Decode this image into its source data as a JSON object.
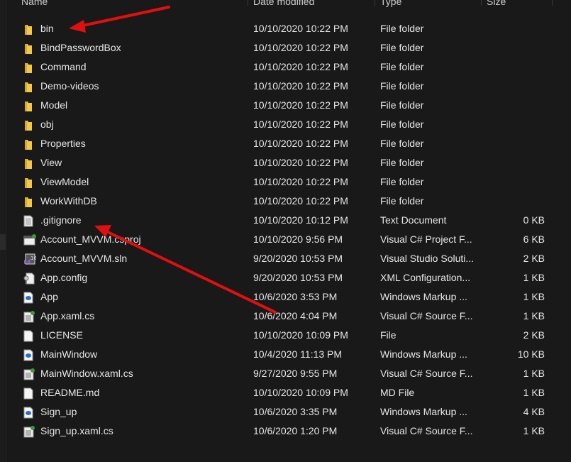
{
  "columns": {
    "name": "Name",
    "date": "Date modified",
    "type": "Type",
    "size": "Size"
  },
  "files": [
    {
      "name": "bin",
      "date": "10/10/2020 10:22 PM",
      "type": "File folder",
      "size": "",
      "icon": "folder"
    },
    {
      "name": "BindPasswordBox",
      "date": "10/10/2020 10:22 PM",
      "type": "File folder",
      "size": "",
      "icon": "folder"
    },
    {
      "name": "Command",
      "date": "10/10/2020 10:22 PM",
      "type": "File folder",
      "size": "",
      "icon": "folder"
    },
    {
      "name": "Demo-videos",
      "date": "10/10/2020 10:22 PM",
      "type": "File folder",
      "size": "",
      "icon": "folder"
    },
    {
      "name": "Model",
      "date": "10/10/2020 10:22 PM",
      "type": "File folder",
      "size": "",
      "icon": "folder"
    },
    {
      "name": "obj",
      "date": "10/10/2020 10:22 PM",
      "type": "File folder",
      "size": "",
      "icon": "folder"
    },
    {
      "name": "Properties",
      "date": "10/10/2020 10:22 PM",
      "type": "File folder",
      "size": "",
      "icon": "folder"
    },
    {
      "name": "View",
      "date": "10/10/2020 10:22 PM",
      "type": "File folder",
      "size": "",
      "icon": "folder"
    },
    {
      "name": "ViewModel",
      "date": "10/10/2020 10:22 PM",
      "type": "File folder",
      "size": "",
      "icon": "folder"
    },
    {
      "name": "WorkWithDB",
      "date": "10/10/2020 10:22 PM",
      "type": "File folder",
      "size": "",
      "icon": "folder"
    },
    {
      "name": ".gitignore",
      "date": "10/10/2020 10:12 PM",
      "type": "Text Document",
      "size": "0 KB",
      "icon": "text"
    },
    {
      "name": "Account_MVVM.csproj",
      "date": "10/10/2020 9:56 PM",
      "type": "Visual C# Project F...",
      "size": "6 KB",
      "icon": "csproj"
    },
    {
      "name": "Account_MVVM.sln",
      "date": "9/20/2020 10:53 PM",
      "type": "Visual Studio Soluti...",
      "size": "2 KB",
      "icon": "sln"
    },
    {
      "name": "App.config",
      "date": "9/20/2020 10:53 PM",
      "type": "XML Configuration...",
      "size": "1 KB",
      "icon": "config"
    },
    {
      "name": "App",
      "date": "10/6/2020 3:53 PM",
      "type": "Windows Markup ...",
      "size": "1 KB",
      "icon": "xaml"
    },
    {
      "name": "App.xaml.cs",
      "date": "10/6/2020 4:04 PM",
      "type": "Visual C# Source F...",
      "size": "1 KB",
      "icon": "cs"
    },
    {
      "name": "LICENSE",
      "date": "10/10/2020 10:09 PM",
      "type": "File",
      "size": "2 KB",
      "icon": "file"
    },
    {
      "name": "MainWindow",
      "date": "10/4/2020 11:13 PM",
      "type": "Windows Markup ...",
      "size": "10 KB",
      "icon": "xaml"
    },
    {
      "name": "MainWindow.xaml.cs",
      "date": "9/27/2020 9:55 PM",
      "type": "Visual C# Source F...",
      "size": "1 KB",
      "icon": "cs"
    },
    {
      "name": "README.md",
      "date": "10/10/2020 10:09 PM",
      "type": "MD File",
      "size": "1 KB",
      "icon": "file"
    },
    {
      "name": "Sign_up",
      "date": "10/6/2020 3:35 PM",
      "type": "Windows Markup ...",
      "size": "4 KB",
      "icon": "xaml"
    },
    {
      "name": "Sign_up.xaml.cs",
      "date": "10/6/2020 1:20 PM",
      "type": "Visual C# Source F...",
      "size": "1 KB",
      "icon": "cs"
    }
  ],
  "colors": {
    "background": "#191919",
    "folder": "#f3c849",
    "arrow": "#e01010"
  }
}
